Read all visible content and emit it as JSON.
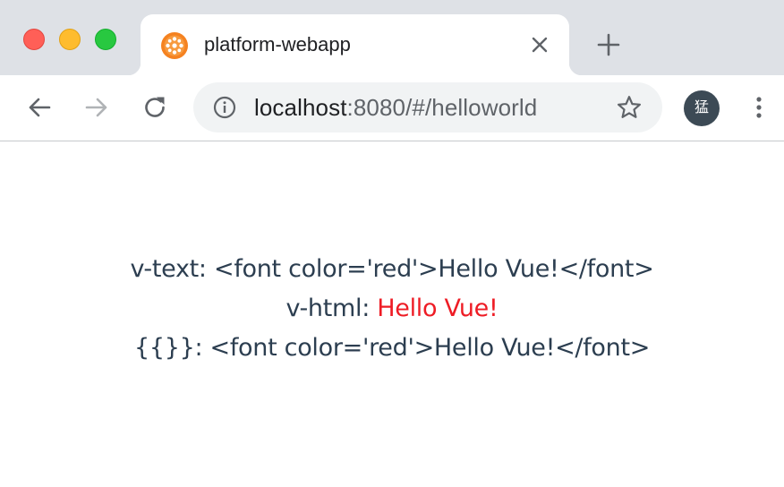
{
  "window": {
    "controls": [
      "close",
      "minimize",
      "zoom"
    ]
  },
  "tab": {
    "title": "platform-webapp",
    "favicon": "orange-flower-logo-icon",
    "close_icon": "close-icon"
  },
  "new_tab_icon": "plus-icon",
  "toolbar": {
    "back_icon": "arrow-left-icon",
    "forward_icon": "arrow-right-icon",
    "reload_icon": "reload-icon",
    "address": {
      "host": "localhost",
      "rest": ":8080/#/helloworld",
      "info_icon": "info-icon",
      "bookmark_icon": "star-outline-icon"
    },
    "profile_avatar": "猛",
    "menu_icon": "more-vertical-icon"
  },
  "page": {
    "line1": "v-text: <font color='red'>Hello Vue!</font>",
    "line2_label": "v-html: ",
    "line2_value": "Hello Vue!",
    "line3": "{{}}: <font color='red'>Hello Vue!</font>"
  },
  "colors": {
    "tab_strip": "#dee1e6",
    "omnibox": "#f1f3f4",
    "text": "#2c3e50",
    "red": "#ee1c25",
    "avatar_bg": "#3c4a55"
  }
}
